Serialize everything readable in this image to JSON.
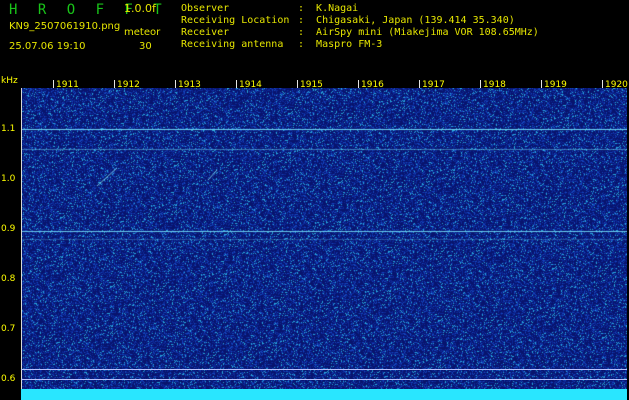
{
  "header": {
    "brand": "H R O F F T",
    "version": "1.0.0f",
    "filename": "KN9_2507061910.png",
    "mode": "meteor",
    "datetime": "25.07.06 19:10",
    "interval": "30",
    "info": [
      {
        "key": "Observer",
        "value": ":  K.Nagai"
      },
      {
        "key": "Receiving Location",
        "value": ":  Chigasaki, Japan (139.414 35.340)"
      },
      {
        "key": "Receiver",
        "value": ":  AirSpy mini (Miakejima VOR 108.65MHz)"
      },
      {
        "key": "Receiving antenna",
        "value": ":  Maspro FM-3"
      }
    ]
  },
  "axis": {
    "unit": "kHz",
    "time_labels": [
      "1911",
      "1912",
      "1913",
      "1914",
      "1915",
      "1916",
      "1917",
      "1918",
      "1919",
      "1920"
    ],
    "freq_labels": [
      {
        "label": "1.1",
        "value": 1.1
      },
      {
        "label": "1.0",
        "value": 1.0
      },
      {
        "label": "0.9",
        "value": 0.9
      },
      {
        "label": "0.8",
        "value": 0.8
      },
      {
        "label": "0.7",
        "value": 0.7
      },
      {
        "label": "0.6",
        "value": 0.6
      }
    ]
  },
  "colors": {
    "background": "#08146e",
    "signal": "#29e6ff",
    "label": "#ffff00",
    "brand": "#19c419"
  }
}
